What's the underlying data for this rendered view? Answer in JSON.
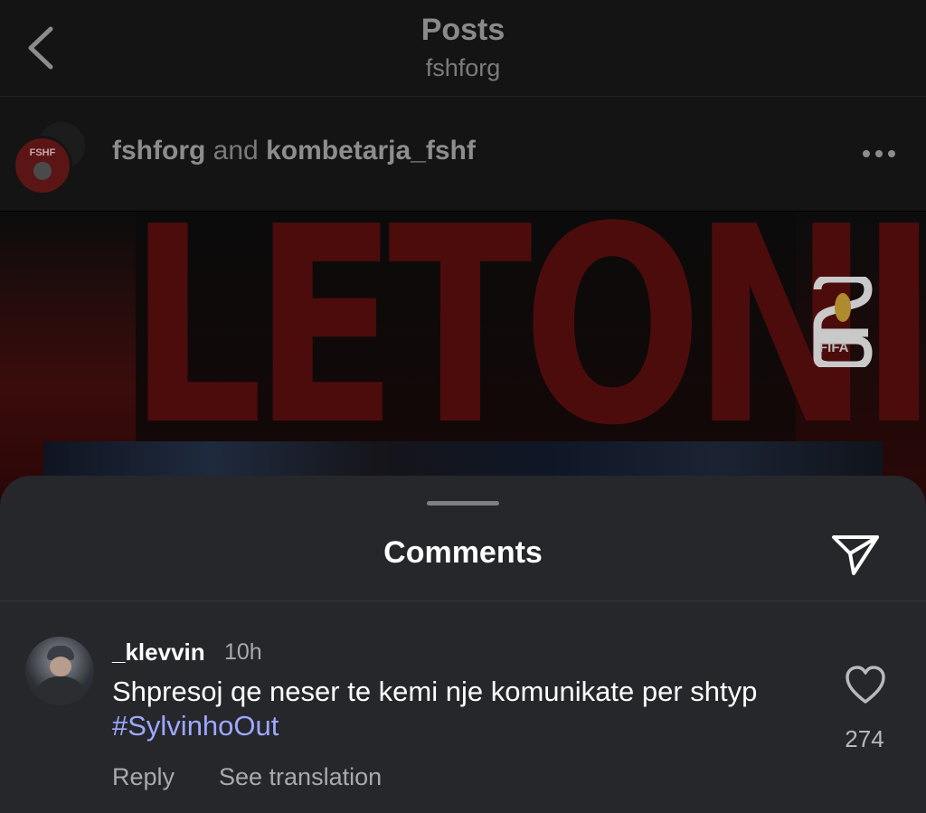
{
  "header": {
    "title": "Posts",
    "subtitle": "fshforg",
    "back_icon": "chevron-left-icon"
  },
  "post": {
    "author_primary": "fshforg",
    "connector": "and",
    "author_secondary": "kombetarja_fshf",
    "avatar_crest_text": "FSHF",
    "more_icon": "more-horizontal-icon",
    "image": {
      "headline": "LETONI",
      "logo_text": "FIFA"
    }
  },
  "comments_sheet": {
    "title": "Comments",
    "share_icon": "send-icon",
    "comments": [
      {
        "username": "_klevvin",
        "time": "10h",
        "text": "Shpresoj qe neser te kemi nje komunikate per shtyp ",
        "hashtag": "#SylvinhoOut",
        "like_count": "274",
        "reply_label": "Reply",
        "translate_label": "See translation"
      }
    ]
  },
  "colors": {
    "sheet_bg": "#25272b",
    "hashtag": "#9ea8ff",
    "muted_text": "#a8aaae"
  }
}
